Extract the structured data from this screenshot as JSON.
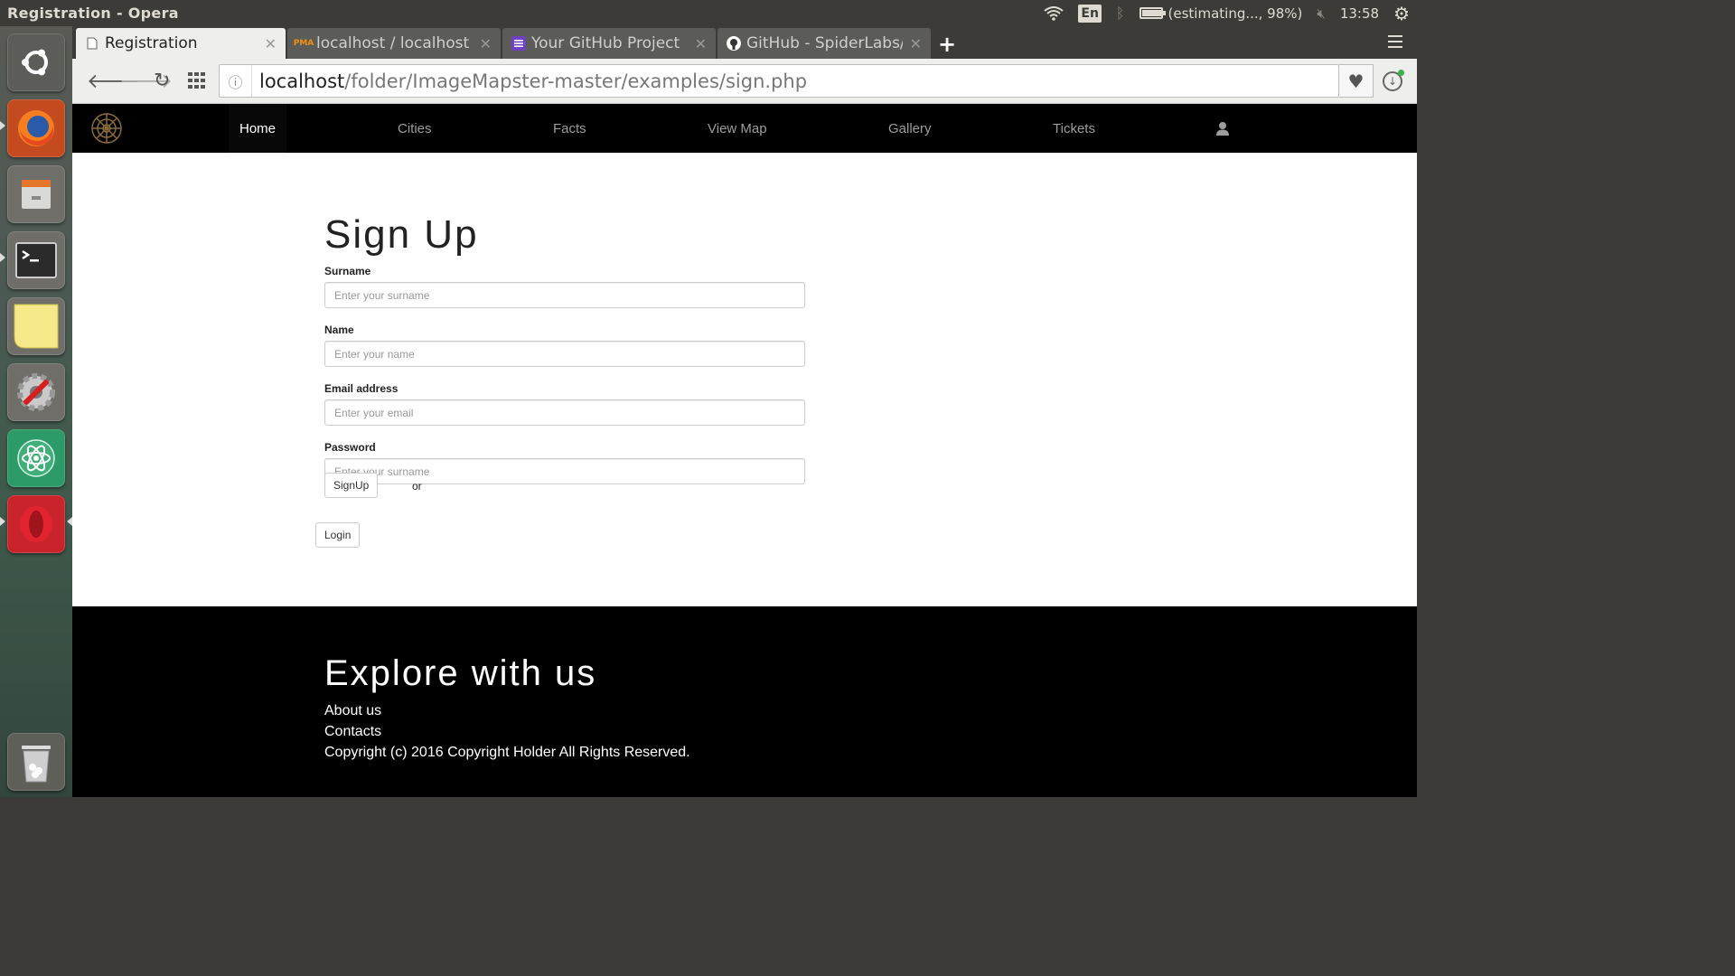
{
  "os_panel": {
    "window_title": "Registration - Opera",
    "language": "En",
    "battery_text": "(estimating..., 98%)",
    "battery_level": 0.98,
    "clock": "13:58"
  },
  "launcher": {
    "items": [
      "ubuntu-dash",
      "firefox",
      "files",
      "terminal",
      "notes",
      "system-settings",
      "atom",
      "opera",
      "trash"
    ]
  },
  "browser": {
    "tabs": [
      {
        "title": "Registration",
        "active": true
      },
      {
        "title": "localhost / localhost /",
        "active": false
      },
      {
        "title": "Your GitHub Project",
        "active": false
      },
      {
        "title": "GitHub - SpiderLabs/I",
        "active": false
      }
    ],
    "url_host": "localhost",
    "url_path": "/folder/ImageMapster-master/examples/sign.php"
  },
  "site_nav": {
    "items": [
      "Home",
      "Cities",
      "Facts",
      "View Map",
      "Gallery",
      "Tickets"
    ],
    "active": "Home"
  },
  "form": {
    "title": "Sign Up",
    "fields": [
      {
        "label": "Surname",
        "placeholder": "Enter your surname"
      },
      {
        "label": "Name",
        "placeholder": "Enter your name"
      },
      {
        "label": "Email address",
        "placeholder": "Enter your email"
      },
      {
        "label": "Password",
        "placeholder": "Enter your surname"
      }
    ],
    "signup_label": "SignUp",
    "or_text": "or",
    "login_label": "Login"
  },
  "footer": {
    "title": "Explore with us",
    "links": [
      "About us",
      "Contacts"
    ],
    "copyright": "Copyright (c) 2016 Copyright Holder All Rights Reserved."
  }
}
